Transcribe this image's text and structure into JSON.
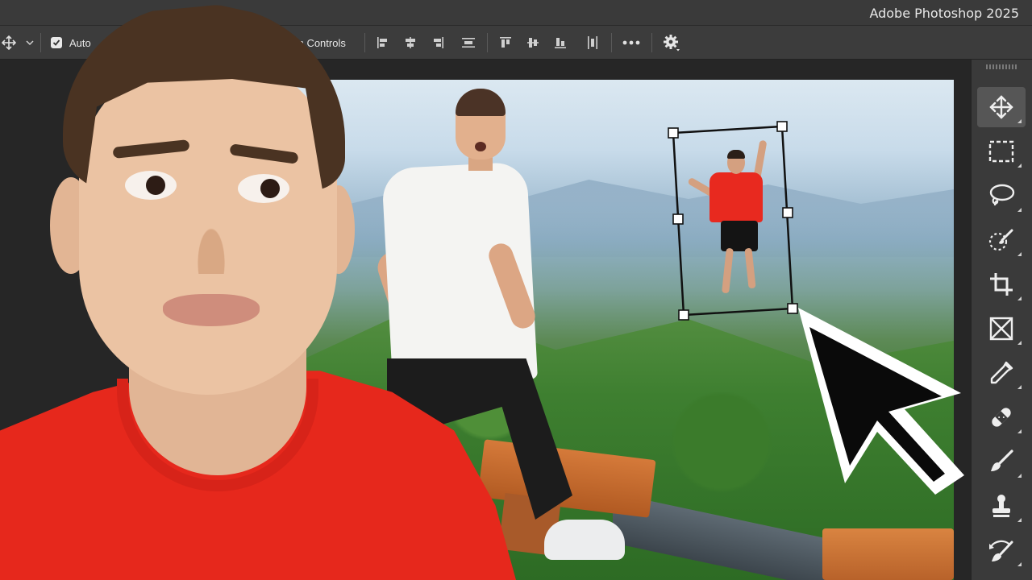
{
  "app": {
    "title": "Adobe Photoshop 2025"
  },
  "options_bar": {
    "move_tool_icon": "move-icon",
    "tool_preset_icon": "chevron-down-icon",
    "auto_select_checked": true,
    "auto_select_label_visible": "Auto",
    "transform_controls_label_visible": "m Controls",
    "align_icons": [
      "align-left-edges-icon",
      "align-horizontal-centers-icon",
      "align-right-edges-icon",
      "distribute-horizontal-icon",
      "align-top-edges-icon",
      "align-vertical-centers-icon",
      "align-bottom-edges-icon",
      "distribute-vertical-icon"
    ],
    "more_icon": "more-icon",
    "settings_icon": "gear-icon"
  },
  "tools_panel": {
    "items": [
      {
        "name": "move-tool",
        "icon": "move-icon",
        "active": true
      },
      {
        "name": "rectangular-marquee-tool",
        "icon": "marquee-icon",
        "active": false
      },
      {
        "name": "lasso-tool",
        "icon": "lasso-icon",
        "active": false
      },
      {
        "name": "object-selection-tool",
        "icon": "object-selection-icon",
        "active": false
      },
      {
        "name": "crop-tool",
        "icon": "crop-icon",
        "active": false
      },
      {
        "name": "frame-tool",
        "icon": "frame-icon",
        "active": false
      },
      {
        "name": "eyedropper-tool",
        "icon": "eyedropper-icon",
        "active": false
      },
      {
        "name": "spot-healing-brush-tool",
        "icon": "healing-bandage-icon",
        "active": false
      },
      {
        "name": "brush-tool",
        "icon": "brush-icon",
        "active": false
      },
      {
        "name": "clone-stamp-tool",
        "icon": "stamp-icon",
        "active": false
      },
      {
        "name": "history-brush-tool",
        "icon": "history-brush-icon",
        "active": false
      }
    ]
  },
  "colors": {
    "ui_dark": "#3a3a3a",
    "accent_shirt_red": "#e6281c"
  }
}
